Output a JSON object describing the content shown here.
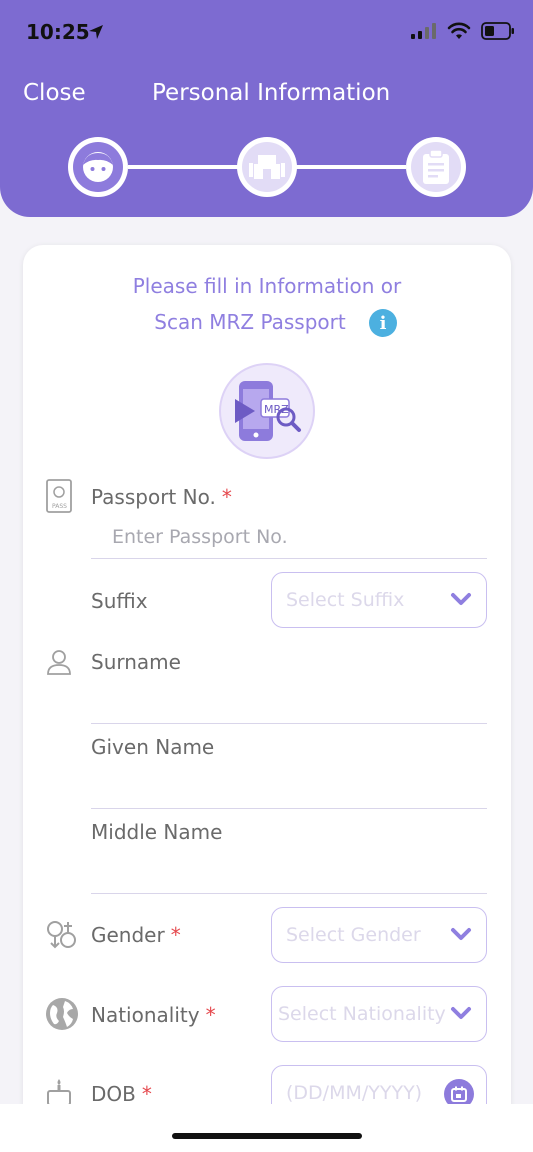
{
  "status": {
    "time": "10:25"
  },
  "header": {
    "close_label": "Close",
    "title": "Personal Information"
  },
  "stepper": {
    "steps": [
      "face-icon",
      "home-icon",
      "clipboard-icon"
    ],
    "active_index": 0
  },
  "intro": {
    "line1": "Please fill in Information or",
    "line2": "Scan MRZ Passport",
    "scan_icon_text": "MRZ"
  },
  "fields": {
    "passport": {
      "label": "Passport No.",
      "required": "*",
      "placeholder": "Enter Passport No."
    },
    "suffix": {
      "label": "Suffix",
      "placeholder": "Select Suffix"
    },
    "surname": {
      "label": "Surname"
    },
    "given_name": {
      "label": "Given Name"
    },
    "middle_name": {
      "label": "Middle Name"
    },
    "gender": {
      "label": "Gender",
      "required": "*",
      "placeholder": "Select Gender"
    },
    "nationality": {
      "label": "Nationality",
      "required": "*",
      "placeholder": "Select Nationality"
    },
    "dob": {
      "label": "DOB",
      "required": "*",
      "placeholder": "(DD/MM/YYYY)"
    }
  },
  "colors": {
    "header": "#7d6bd1",
    "accent": "#8f7fe0",
    "required": "#e5484d",
    "info": "#4cb0e0"
  }
}
